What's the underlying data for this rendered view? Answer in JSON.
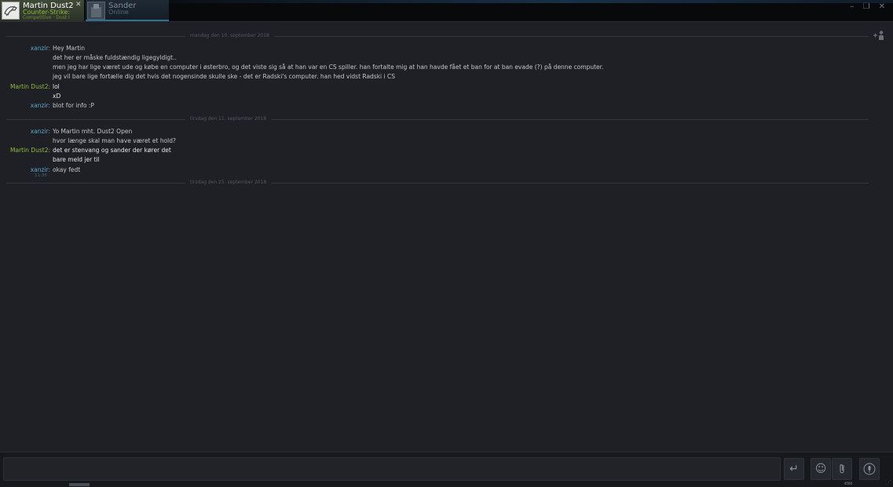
{
  "tabs": [
    {
      "name": "Martin Dust2",
      "status": "Counter-Strike: Gl",
      "sub": "Competitive · Dust II",
      "close_glyph": "✕"
    },
    {
      "name": "Sander",
      "status": "Online"
    }
  ],
  "window_controls": "– ❐ ✕",
  "date_separators": [
    "mandag den 10. september 2018",
    "tirsdag den 11. september 2018",
    "tirsdag den 25. september 2018"
  ],
  "messages": [
    {
      "sender": "xanzir:",
      "text": "Hey Martin"
    },
    {
      "sender": "",
      "text": "det her er måske fuldstændig ligegyldigt.."
    },
    {
      "sender": "",
      "text": "men jeg har lige været ude og købe en computer i østerbro, og det viste sig så at han var en CS spiller. han fortalte mig at han havde fået et ban for at ban evade (?) på denne computer."
    },
    {
      "sender": "",
      "text": "jeg vil bare lige fortælle dig det hvis det nogensinde skulle ske - det er Radski's computer. han hed vidst Radski i CS"
    },
    {
      "sender": "Martin Dust2:",
      "text": "lol"
    },
    {
      "sender": "",
      "text": "xD"
    },
    {
      "sender": "xanzir:",
      "text": "blot for info :P"
    },
    {
      "sender": "xanzir:",
      "text": "Yo Martin mht. Dust2 Open"
    },
    {
      "sender": "",
      "text": "hvor længe skal man have været et hold?"
    },
    {
      "sender": "Martin Dust2:",
      "text": "det er stenvang og sander der kører det"
    },
    {
      "sender": "",
      "text": "bare meld jer til"
    },
    {
      "sender": "xanzir:",
      "text": "okay fedt"
    }
  ],
  "last_timestamp": "11:35",
  "input": {
    "placeholder": ""
  },
  "buttons": {
    "send": "↵",
    "emoji": "☺",
    "attach": "⌕",
    "voice": "🎙"
  },
  "corner_text": "4500"
}
